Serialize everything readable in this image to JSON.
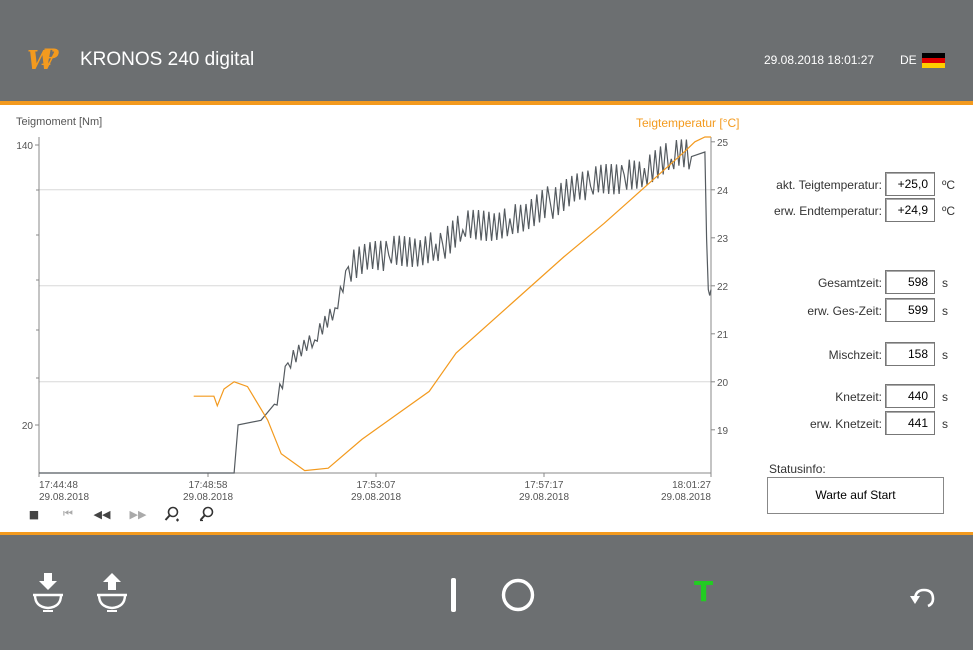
{
  "header": {
    "logo_icon": "wp-logo-icon",
    "title": "KRONOS 240 digital",
    "datetime": "29.08.2018 18:01:27",
    "language": "DE",
    "flag_icon": "german-flag-icon",
    "accent_color": "#f39a1e",
    "bar_color": "#6c6f71"
  },
  "chart": {
    "left_axis_title": "Teigmoment [Nm]",
    "right_axis_title": "Teigtemperatur [°C]",
    "left_ticks": [
      "140",
      "20"
    ],
    "right_ticks": [
      "25",
      "24",
      "23",
      "22",
      "21",
      "20",
      "19"
    ],
    "x_ticks": [
      {
        "time": "17:44:48",
        "date": "29.08.2018"
      },
      {
        "time": "17:48:58",
        "date": "29.08.2018"
      },
      {
        "time": "17:53:07",
        "date": "29.08.2018"
      },
      {
        "time": "17:57:17",
        "date": "29.08.2018"
      },
      {
        "time": "18:01:27",
        "date": "29.08.2018"
      }
    ],
    "controls": [
      "stop-icon",
      "skip-start-icon",
      "rewind-icon",
      "fast-forward-icon",
      "zoom-in-icon",
      "zoom-out-icon"
    ]
  },
  "chart_data": {
    "type": "line",
    "xlabel": "",
    "x_range": [
      "17:44:48",
      "18:01:27"
    ],
    "y_left": {
      "label": "Teigmoment [Nm]",
      "ylim": [
        0,
        140
      ]
    },
    "y_right": {
      "label": "Teigtemperatur [°C]",
      "ylim": [
        18.1,
        25.1
      ]
    },
    "series": [
      {
        "name": "Teigmoment [Nm]",
        "axis": "left",
        "color": "#555b60",
        "x_seconds": [
          0,
          270,
          290,
          296,
          330,
          350,
          370,
          410,
          440,
          460,
          520,
          590,
          600,
          630,
          700,
          760,
          820,
          870,
          900,
          940,
          970,
          990,
          995,
          999
        ],
        "values": [
          0,
          0,
          0,
          21,
          23,
          30,
          48,
          58,
          72,
          90,
          95,
          100,
          100,
          106,
          111,
          118,
          125,
          130,
          133,
          137,
          138,
          140,
          80,
          80
        ]
      },
      {
        "name": "Teigtemperatur [°C]",
        "axis": "right",
        "color": "#f39a1e",
        "x_seconds": [
          230,
          260,
          265,
          275,
          290,
          310,
          340,
          360,
          395,
          430,
          480,
          530,
          580,
          620,
          700,
          780,
          840,
          880,
          920,
          960,
          975,
          990,
          999
        ],
        "values": [
          19.7,
          19.7,
          19.5,
          19.85,
          20.0,
          19.9,
          19.2,
          18.5,
          18.15,
          18.2,
          18.8,
          19.3,
          19.8,
          20.6,
          21.6,
          22.6,
          23.3,
          23.8,
          24.3,
          24.8,
          25.0,
          25.1,
          25.1
        ]
      }
    ]
  },
  "fields": {
    "akt_temp": {
      "label": "akt. Teigtemperatur:",
      "value": "+25,0",
      "unit": "ºC"
    },
    "erw_temp": {
      "label": "erw. Endtemperatur:",
      "value": "+24,9",
      "unit": "ºC"
    },
    "gesamtzeit": {
      "label": "Gesamtzeit:",
      "value": "598",
      "unit": "s"
    },
    "erw_ges_zeit": {
      "label": "erw. Ges-Zeit:",
      "value": "599",
      "unit": "s"
    },
    "mischzeit": {
      "label": "Mischzeit:",
      "value": "158",
      "unit": "s"
    },
    "knetzeit": {
      "label": "Knetzeit:",
      "value": "440",
      "unit": "s"
    },
    "erw_knetzeit": {
      "label": "erw. Knetzeit:",
      "value": "441",
      "unit": "s"
    }
  },
  "status": {
    "label": "Statusinfo:",
    "value": "Warte auf Start"
  },
  "footer": {
    "buttons": [
      "bowl-load-icon",
      "bowl-unload-icon",
      "power-on-icon",
      "power-off-icon",
      "tool-t-icon",
      "back-undo-icon"
    ],
    "tool_label": "T",
    "tool_color": "#22cc22"
  }
}
